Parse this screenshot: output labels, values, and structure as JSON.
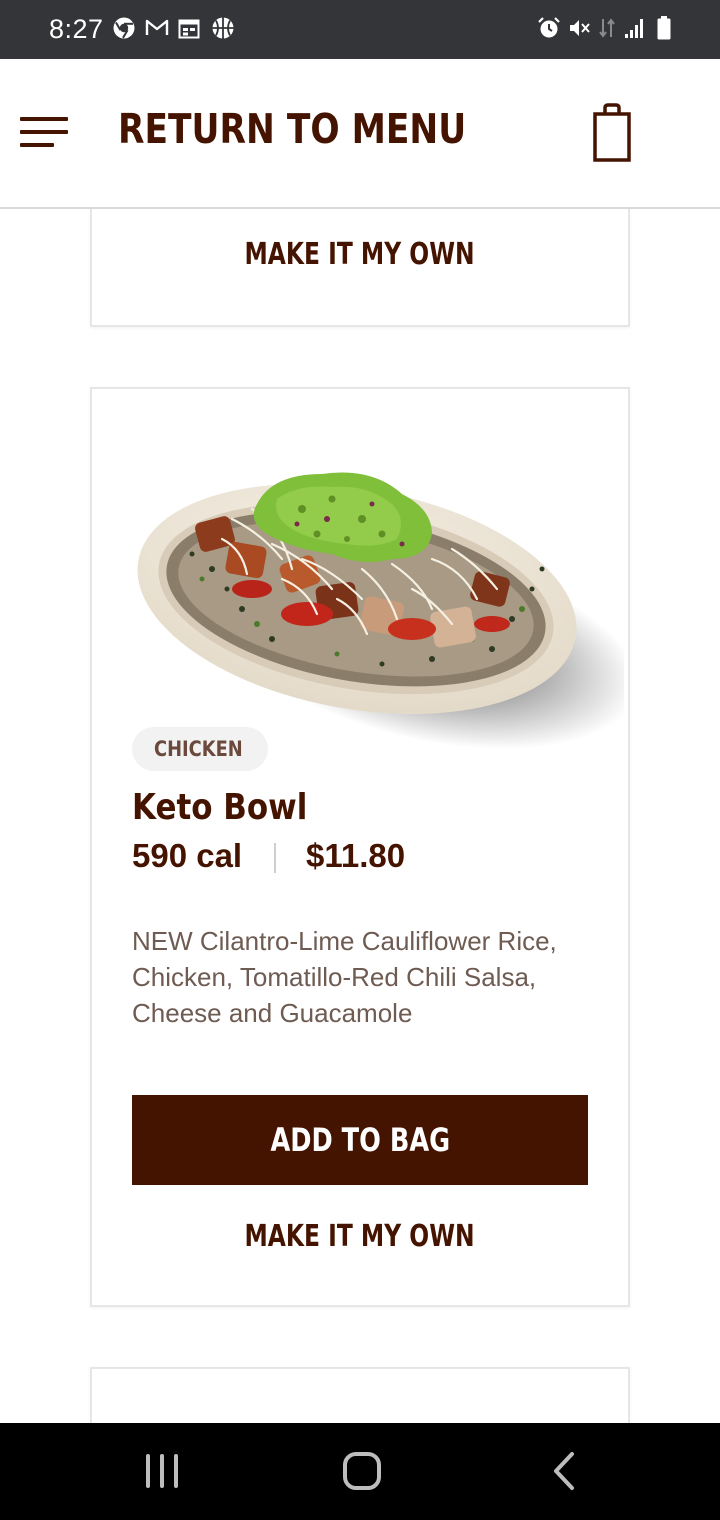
{
  "status_bar": {
    "time": "8:27",
    "left_icons": [
      "chrome-icon",
      "gmail-icon",
      "calendar-icon",
      "basketball-icon"
    ],
    "right_icons": [
      "alarm-icon",
      "mute-icon",
      "data-icon",
      "signal-icon",
      "battery-icon"
    ]
  },
  "header": {
    "title": "RETURN TO MENU",
    "menu_icon": "hamburger-menu-icon",
    "bag_icon": "shopping-bag-icon"
  },
  "previous_card": {
    "make_it_my_own_label": "MAKE IT MY OWN"
  },
  "item": {
    "tag": "CHICKEN",
    "name": "Keto Bowl",
    "calories": "590 cal",
    "price": "$11.80",
    "description": "NEW Cilantro-Lime Cauliflower Rice, Chicken, Tomatillo-Red Chili Salsa, Cheese and Guacamole",
    "add_to_bag_label": "ADD TO BAG",
    "make_it_my_own_label": "MAKE IT MY OWN"
  },
  "nav_bar": {
    "recents_icon": "recents-icon",
    "home_icon": "home-icon",
    "back_icon": "back-icon"
  },
  "colors": {
    "brand_brown": "#451400",
    "status_bar": "#343538",
    "nav_bar": "#000000",
    "tag_background": "#f2f2f2",
    "description_text": "#6e5b52"
  }
}
